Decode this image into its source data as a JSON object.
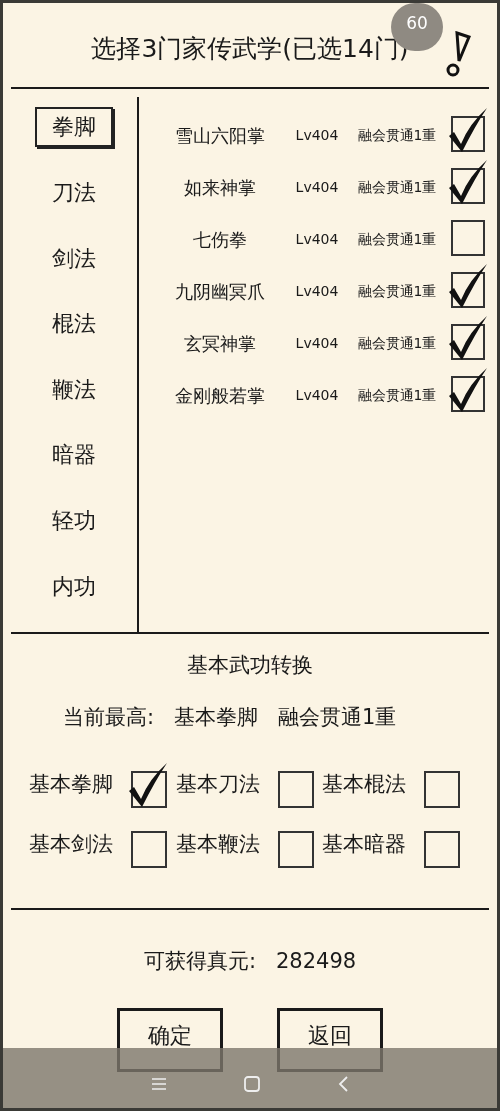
{
  "title": "选择3门家传武学(已选14门)",
  "fps": "60",
  "categories": [
    {
      "label": "拳脚",
      "selected": true
    },
    {
      "label": "刀法",
      "selected": false
    },
    {
      "label": "剑法",
      "selected": false
    },
    {
      "label": "棍法",
      "selected": false
    },
    {
      "label": "鞭法",
      "selected": false
    },
    {
      "label": "暗器",
      "selected": false
    },
    {
      "label": "轻功",
      "selected": false
    },
    {
      "label": "内功",
      "selected": false
    }
  ],
  "skills": [
    {
      "name": "雪山六阳掌",
      "level": "Lv404",
      "rank": "融会贯通1重",
      "checked": true
    },
    {
      "name": "如来神掌",
      "level": "Lv404",
      "rank": "融会贯通1重",
      "checked": true
    },
    {
      "name": "七伤拳",
      "level": "Lv404",
      "rank": "融会贯通1重",
      "checked": false
    },
    {
      "name": "九阴幽冥爪",
      "level": "Lv404",
      "rank": "融会贯通1重",
      "checked": true
    },
    {
      "name": "玄冥神掌",
      "level": "Lv404",
      "rank": "融会贯通1重",
      "checked": true
    },
    {
      "name": "金刚般若掌",
      "level": "Lv404",
      "rank": "融会贯通1重",
      "checked": true
    }
  ],
  "conversion": {
    "title": "基本武功转换",
    "current_label": "当前最高:",
    "current_skill": "基本拳脚",
    "current_rank": "融会贯通1重",
    "options": [
      {
        "label": "基本拳脚",
        "checked": true
      },
      {
        "label": "基本刀法",
        "checked": false
      },
      {
        "label": "基本棍法",
        "checked": false
      },
      {
        "label": "基本剑法",
        "checked": false
      },
      {
        "label": "基本鞭法",
        "checked": false
      },
      {
        "label": "基本暗器",
        "checked": false
      }
    ]
  },
  "reward": {
    "label": "可获得真元:",
    "value": "282498"
  },
  "buttons": [
    "确定",
    "返回"
  ]
}
